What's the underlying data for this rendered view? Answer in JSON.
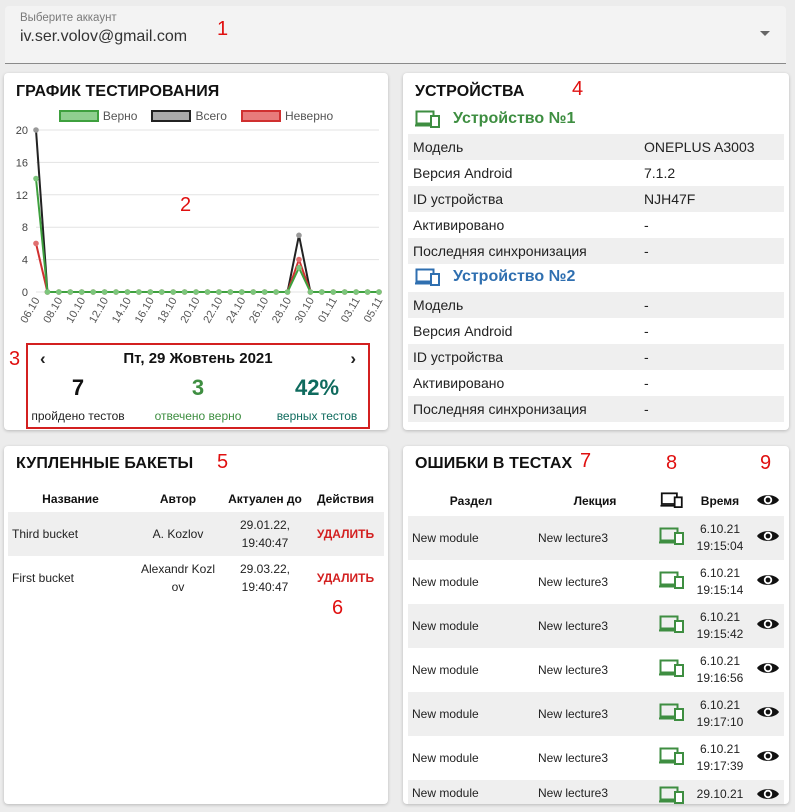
{
  "account": {
    "label": "Выберите аккаунт",
    "value": "iv.ser.volov@gmail.com"
  },
  "markers": [
    "1",
    "2",
    "3",
    "4",
    "5",
    "6",
    "7",
    "8",
    "9"
  ],
  "colors": {
    "green": "#3e8e41",
    "teal": "#0f6b5e",
    "blue": "#2f6fb0",
    "red": "#d32020",
    "marker": "#e01010"
  },
  "chart": {
    "title": "ГРАФИК ТЕСТИРОВАНИЯ",
    "legend": [
      {
        "label": "Верно",
        "fill": "#8fcf8f",
        "stroke": "#3ea03e"
      },
      {
        "label": "Всего",
        "fill": "#aaaaaa",
        "stroke": "#222222"
      },
      {
        "label": "Неверно",
        "fill": "#e87b7b",
        "stroke": "#d03030"
      }
    ]
  },
  "chart_data": {
    "type": "line",
    "x": [
      "06.10",
      "07.10",
      "08.10",
      "09.10",
      "10.10",
      "11.10",
      "12.10",
      "13.10",
      "14.10",
      "15.10",
      "16.10",
      "17.10",
      "18.10",
      "19.10",
      "20.10",
      "21.10",
      "22.10",
      "23.10",
      "24.10",
      "25.10",
      "26.10",
      "27.10",
      "28.10",
      "29.10",
      "30.10",
      "31.10",
      "01.11",
      "02.11",
      "03.11",
      "04.11",
      "05.11"
    ],
    "xtick_labels": [
      "06.10",
      "08.10",
      "10.10",
      "12.10",
      "14.10",
      "16.10",
      "18.10",
      "20.10",
      "22.10",
      "24.10",
      "26.10",
      "28.10",
      "30.10",
      "01.11",
      "03.11",
      "05.11"
    ],
    "series": [
      {
        "name": "Всего",
        "color": "#999999",
        "line": "#222222",
        "values": [
          20,
          0,
          0,
          0,
          0,
          0,
          0,
          0,
          0,
          0,
          0,
          0,
          0,
          0,
          0,
          0,
          0,
          0,
          0,
          0,
          0,
          0,
          0,
          7,
          0,
          0,
          0,
          0,
          0,
          0,
          0
        ]
      },
      {
        "name": "Неверно",
        "color": "#e07070",
        "line": "#d03030",
        "values": [
          6,
          0,
          0,
          0,
          0,
          0,
          0,
          0,
          0,
          0,
          0,
          0,
          0,
          0,
          0,
          0,
          0,
          0,
          0,
          0,
          0,
          0,
          0,
          4,
          0,
          0,
          0,
          0,
          0,
          0,
          0
        ]
      },
      {
        "name": "Верно",
        "color": "#7cc67c",
        "line": "#3ea03e",
        "values": [
          14,
          0,
          0,
          0,
          0,
          0,
          0,
          0,
          0,
          0,
          0,
          0,
          0,
          0,
          0,
          0,
          0,
          0,
          0,
          0,
          0,
          0,
          0,
          3,
          0,
          0,
          0,
          0,
          0,
          0,
          0
        ]
      }
    ],
    "yticks": [
      0,
      4,
      8,
      12,
      16,
      20
    ],
    "ylim": [
      0,
      20
    ],
    "legend_position": "top"
  },
  "date_panel": {
    "title": "Пт, 29 Жовтень 2021",
    "prev": "‹",
    "next": "›",
    "passed_value": "7",
    "passed_label": "пройдено тестов",
    "correct_value": "3",
    "correct_label": "отвечено верно",
    "percent_value": "42%",
    "percent_label": "верных тестов"
  },
  "devices": {
    "title": "УСТРОЙСТВА",
    "icon": "devices-icon",
    "list": [
      {
        "name": "Устройство №1",
        "color": "#3e8e41",
        "rows": [
          {
            "k": "Модель",
            "v": "ONEPLUS A3003"
          },
          {
            "k": "Версия Android",
            "v": "7.1.2"
          },
          {
            "k": "ID устройства",
            "v": "NJH47F"
          },
          {
            "k": "Активировано",
            "v": "-"
          },
          {
            "k": "Последняя синхронизация",
            "v": "-"
          }
        ]
      },
      {
        "name": "Устройство №2",
        "color": "#2f6fb0",
        "rows": [
          {
            "k": "Модель",
            "v": "-"
          },
          {
            "k": "Версия Android",
            "v": "-"
          },
          {
            "k": "ID устройства",
            "v": "-"
          },
          {
            "k": "Активировано",
            "v": "-"
          },
          {
            "k": "Последняя синхронизация",
            "v": "-"
          }
        ]
      }
    ]
  },
  "buckets": {
    "title": "КУПЛЕННЫЕ БАКЕТЫ",
    "columns": [
      "Название",
      "Автор",
      "Актуален до",
      "Действия"
    ],
    "rows": [
      {
        "name": "Third bucket",
        "author": "A. Kozlov",
        "date": "29.01.22,",
        "time": "19:40:47",
        "action": "УДАЛИТЬ"
      },
      {
        "name": "First bucket",
        "author": "Alexandr Kozl",
        "author2": "ov",
        "date": "29.03.22,",
        "time": "19:40:47",
        "action": "УДАЛИТЬ"
      }
    ]
  },
  "errors": {
    "title": "ОШИБКИ В ТЕСТАХ",
    "columns": {
      "section": "Раздел",
      "lecture": "Лекция",
      "device": "devices-icon",
      "time": "Время",
      "view": "eye-icon"
    },
    "rows": [
      {
        "section": "New module",
        "lecture": "New lecture3",
        "date": "6.10.21",
        "time": "19:15:04"
      },
      {
        "section": "New module",
        "lecture": "New lecture3",
        "date": "6.10.21",
        "time": "19:15:14"
      },
      {
        "section": "New module",
        "lecture": "New lecture3",
        "date": "6.10.21",
        "time": "19:15:42"
      },
      {
        "section": "New module",
        "lecture": "New lecture3",
        "date": "6.10.21",
        "time": "19:16:56"
      },
      {
        "section": "New module",
        "lecture": "New lecture3",
        "date": "6.10.21",
        "time": "19:17:10"
      },
      {
        "section": "New module",
        "lecture": "New lecture3",
        "date": "6.10.21",
        "time": "19:17:39"
      },
      {
        "section": "New module",
        "lecture": "New lecture3",
        "date": "29.10.21",
        "time": ""
      }
    ]
  }
}
